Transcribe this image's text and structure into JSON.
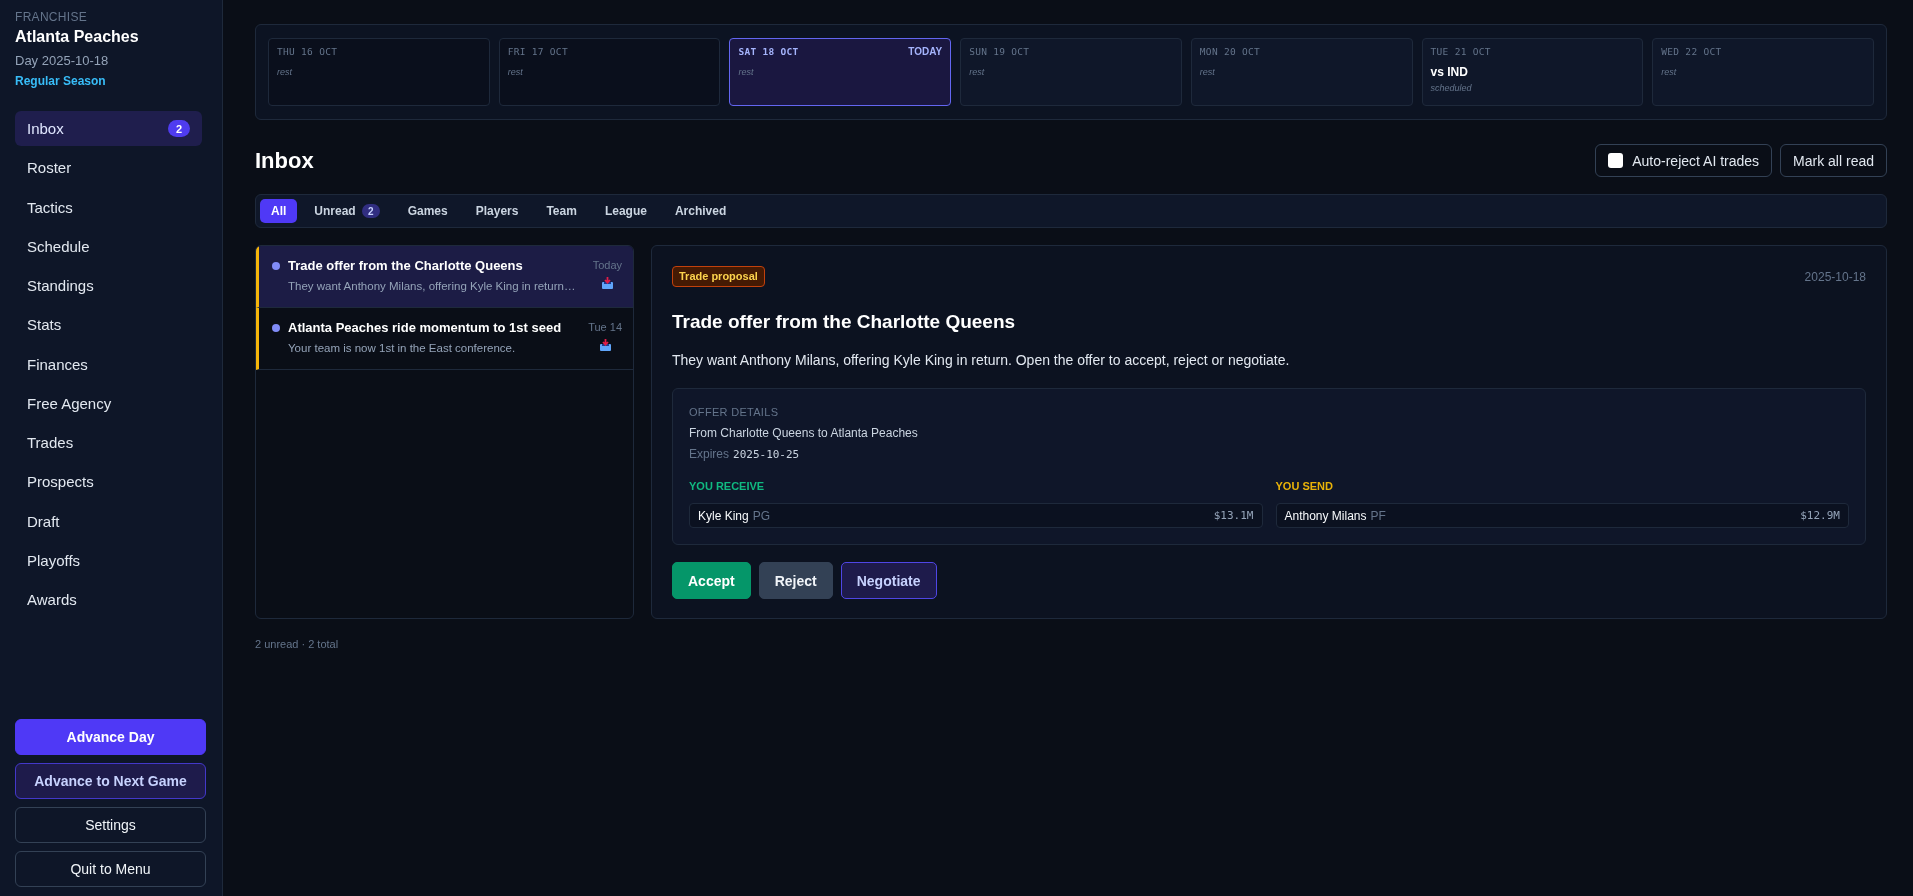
{
  "sidebar": {
    "eyebrow": "FRANCHISE",
    "team": "Atlanta Peaches",
    "day": "Day 2025-10-18",
    "phase": "Regular Season",
    "nav": [
      {
        "label": "Inbox",
        "selected": true,
        "badge": "2"
      },
      {
        "label": "Roster",
        "selected": false
      },
      {
        "label": "Tactics",
        "selected": false
      },
      {
        "label": "Schedule",
        "selected": false
      },
      {
        "label": "Standings",
        "selected": false
      },
      {
        "label": "Stats",
        "selected": false
      },
      {
        "label": "Finances",
        "selected": false
      },
      {
        "label": "Free Agency",
        "selected": false
      },
      {
        "label": "Trades",
        "selected": false
      },
      {
        "label": "Prospects",
        "selected": false
      },
      {
        "label": "Draft",
        "selected": false
      },
      {
        "label": "Playoffs",
        "selected": false
      },
      {
        "label": "Awards",
        "selected": false
      }
    ],
    "actions": [
      {
        "label": "Advance Day",
        "kind": "primary"
      },
      {
        "label": "Advance to Next Game",
        "kind": "secondary"
      },
      {
        "label": "Settings",
        "kind": "outline"
      },
      {
        "label": "Quit to Menu",
        "kind": "outline"
      }
    ]
  },
  "calendar": {
    "days": [
      {
        "label": "THU 16 OCT",
        "kind": "past",
        "note": "rest"
      },
      {
        "label": "FRI 17 OCT",
        "kind": "past",
        "note": "rest"
      },
      {
        "label": "SAT 18 OCT",
        "kind": "today",
        "tag": "TODAY",
        "note": "rest"
      },
      {
        "label": "SUN 19 OCT",
        "kind": "upcoming",
        "note": "rest"
      },
      {
        "label": "MON 20 OCT",
        "kind": "upcoming",
        "note": "rest"
      },
      {
        "label": "TUE 21 OCT",
        "kind": "upcoming",
        "matchup": "vs IND",
        "note": "scheduled"
      },
      {
        "label": "WED 22 OCT",
        "kind": "upcoming",
        "note": "rest"
      }
    ]
  },
  "inbox": {
    "title": "Inbox",
    "auto_reject": {
      "label": "Auto-reject AI trades",
      "checked": false
    },
    "mark_all_read": "Mark all read",
    "tabs": [
      {
        "label": "All",
        "selected": true
      },
      {
        "label": "Unread",
        "selected": false,
        "badge": "2"
      },
      {
        "label": "Games",
        "selected": false
      },
      {
        "label": "Players",
        "selected": false
      },
      {
        "label": "Team",
        "selected": false
      },
      {
        "label": "League",
        "selected": false
      },
      {
        "label": "Archived",
        "selected": false
      }
    ],
    "messages": [
      {
        "title": "Trade offer from the Charlotte Queens",
        "preview": "They want Anthony Milans, offering Kyle King in return…",
        "time": "Today",
        "unread": true,
        "selected": true
      },
      {
        "title": "Atlanta Peaches ride momentum to 1st seed",
        "preview": "Your team is now 1st in the East conference.",
        "time": "Tue 14",
        "unread": true,
        "selected": false
      }
    ],
    "footer": "2 unread · 2 total"
  },
  "detail": {
    "category": "Trade proposal",
    "date": "2025-10-18",
    "title": "Trade offer from the Charlotte Queens",
    "body": "They want Anthony Milans, offering Kyle King in return. Open the offer to accept, reject or negotiate.",
    "offer": {
      "heading": "OFFER DETAILS",
      "route": "From Charlotte Queens to Atlanta Peaches",
      "expires_label": "Expires",
      "expires": "2025-10-25",
      "sides": [
        {
          "heading": "YOU RECEIVE",
          "kind": "receive",
          "players": [
            {
              "name": "Kyle King",
              "position": "PG",
              "salary": "$13.1M"
            }
          ]
        },
        {
          "heading": "YOU SEND",
          "kind": "send",
          "players": [
            {
              "name": "Anthony Milans",
              "position": "PF",
              "salary": "$12.9M"
            }
          ]
        }
      ]
    },
    "actions": [
      {
        "label": "Accept",
        "kind": "accept"
      },
      {
        "label": "Reject",
        "kind": "reject"
      },
      {
        "label": "Negotiate",
        "kind": "negotiate"
      }
    ]
  }
}
